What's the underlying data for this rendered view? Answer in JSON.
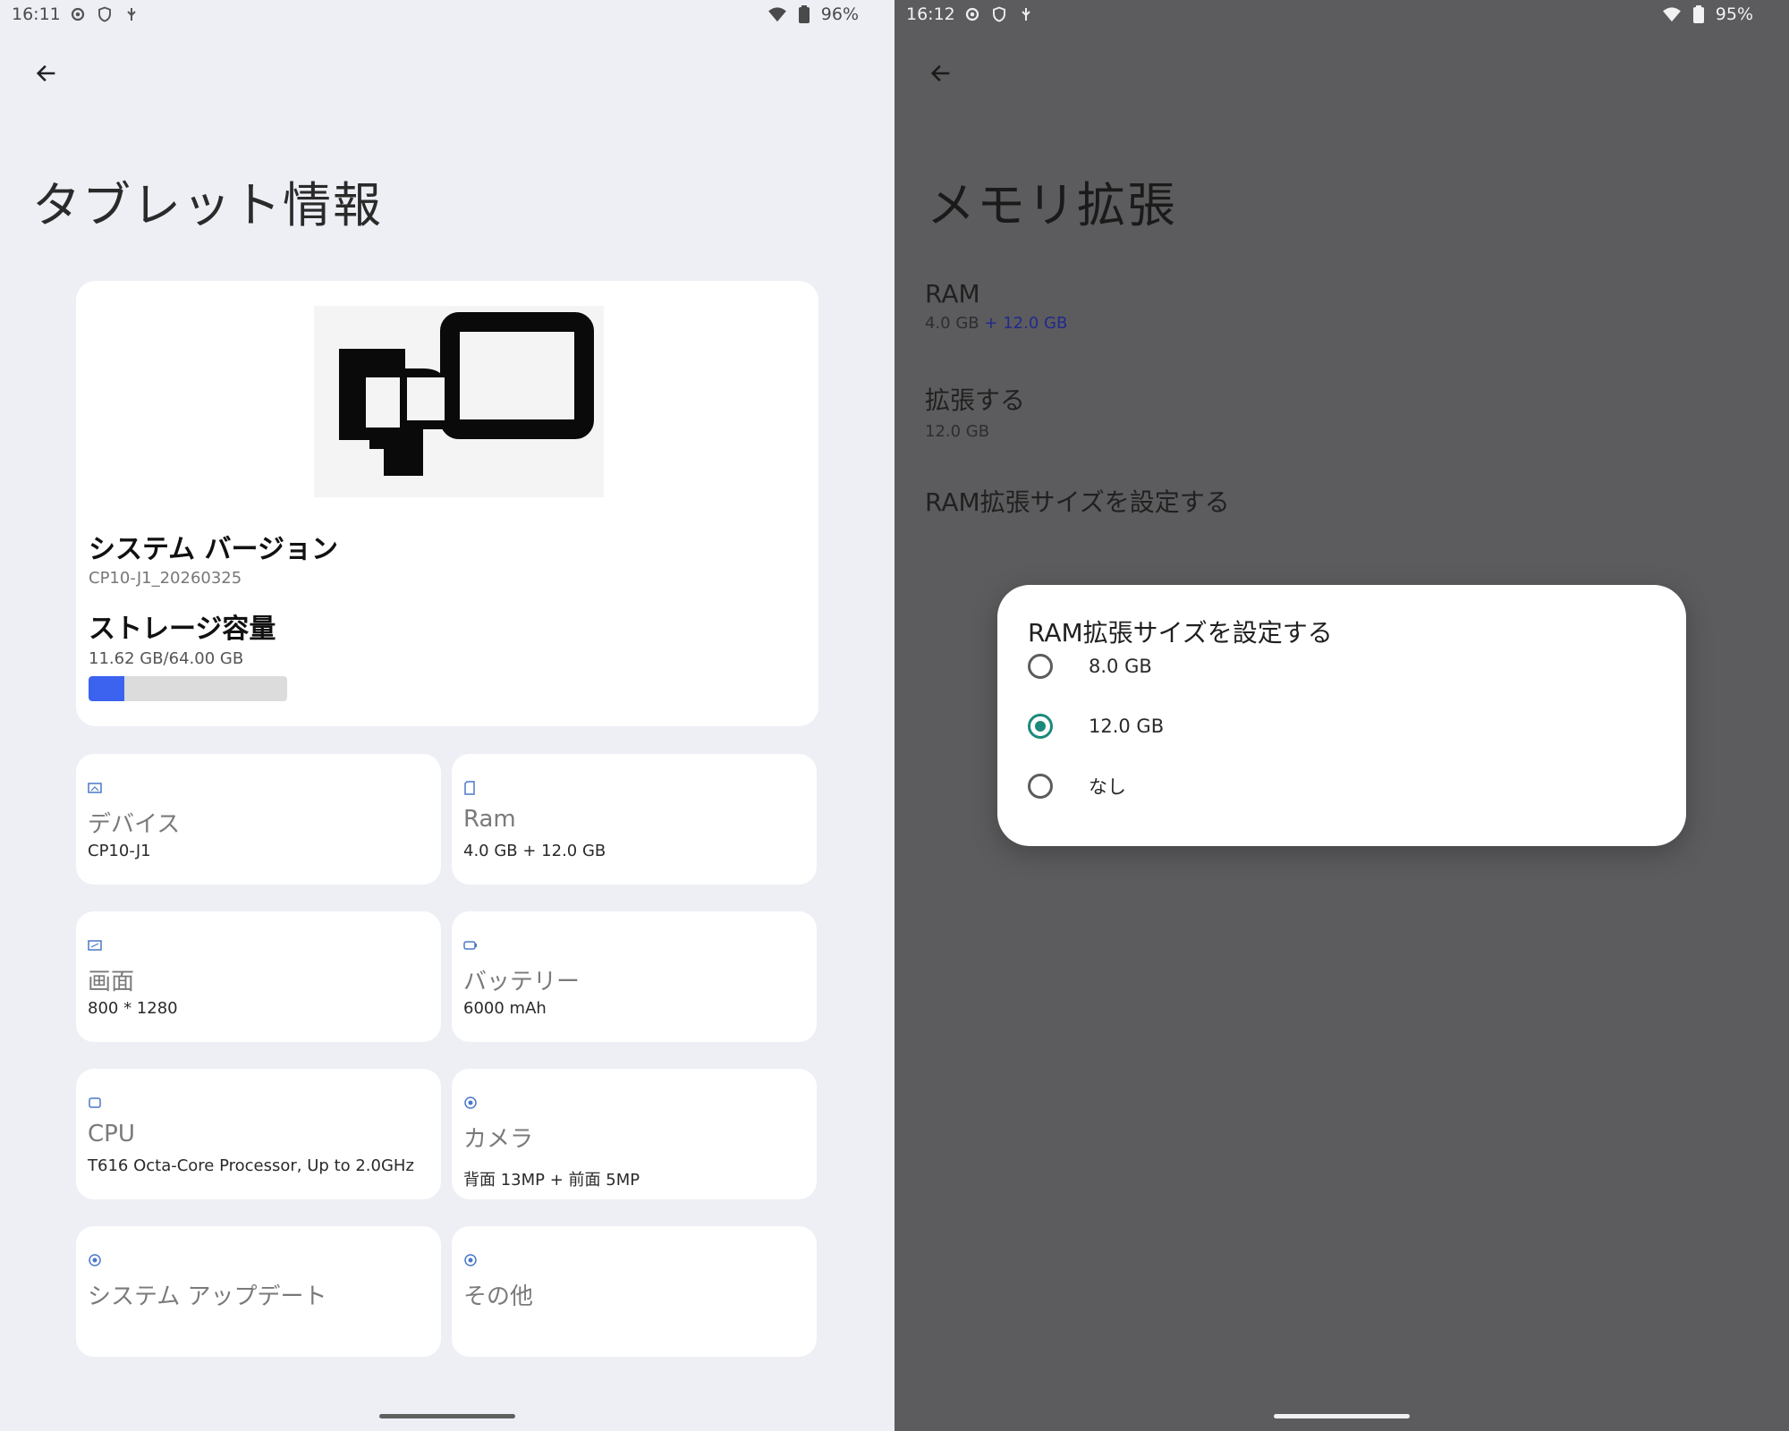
{
  "left": {
    "status": {
      "time": "16:11",
      "battery": "96%"
    },
    "title": "タブレット情報",
    "summary": {
      "system_version_label": "システム バージョン",
      "system_version_value": "CP10-J1_20260325",
      "storage_label": "ストレージ容量",
      "storage_value": "11.62 GB/64.00 GB",
      "storage_fraction": 0.18
    },
    "tiles": [
      {
        "title": "デバイス",
        "value": "CP10-J1",
        "icon": "device-icon"
      },
      {
        "title": "Ram",
        "value": "4.0 GB + 12.0 GB",
        "icon": "memory-icon"
      },
      {
        "title": "画面",
        "value": "800 * 1280",
        "icon": "screen-icon"
      },
      {
        "title": "バッテリー",
        "value": "6000 mAh",
        "icon": "battery-icon"
      },
      {
        "title": "CPU",
        "value": "T616 Octa-Core Processor, Up to 2.0GHz",
        "icon": "cpu-icon"
      },
      {
        "title": "カメラ",
        "value": "背面 13MP + 前面 5MP",
        "icon": "camera-icon"
      },
      {
        "title": "システム アップデート",
        "value": "",
        "icon": "update-icon"
      },
      {
        "title": "その他",
        "value": "",
        "icon": "other-icon"
      }
    ]
  },
  "right": {
    "status": {
      "time": "16:12",
      "battery": "95%"
    },
    "title": "メモリ拡張",
    "ram": {
      "title": "RAM",
      "base": "4.0 GB",
      "plus": "+ 12.0 GB"
    },
    "expand": {
      "title": "拡張する",
      "value": "12.0 GB"
    },
    "set_size_label": "RAM拡張サイズを設定する",
    "dialog": {
      "title": "RAM拡張サイズを設定する",
      "options": [
        {
          "label": "8.0 GB",
          "checked": false
        },
        {
          "label": "12.0 GB",
          "checked": true
        },
        {
          "label": "なし",
          "checked": false
        }
      ]
    }
  },
  "colors": {
    "accent_blue": "#3c63f0",
    "radio_teal": "#1b8a7a",
    "left_bg": "#edeff5",
    "right_bg": "#5c5c5e"
  }
}
